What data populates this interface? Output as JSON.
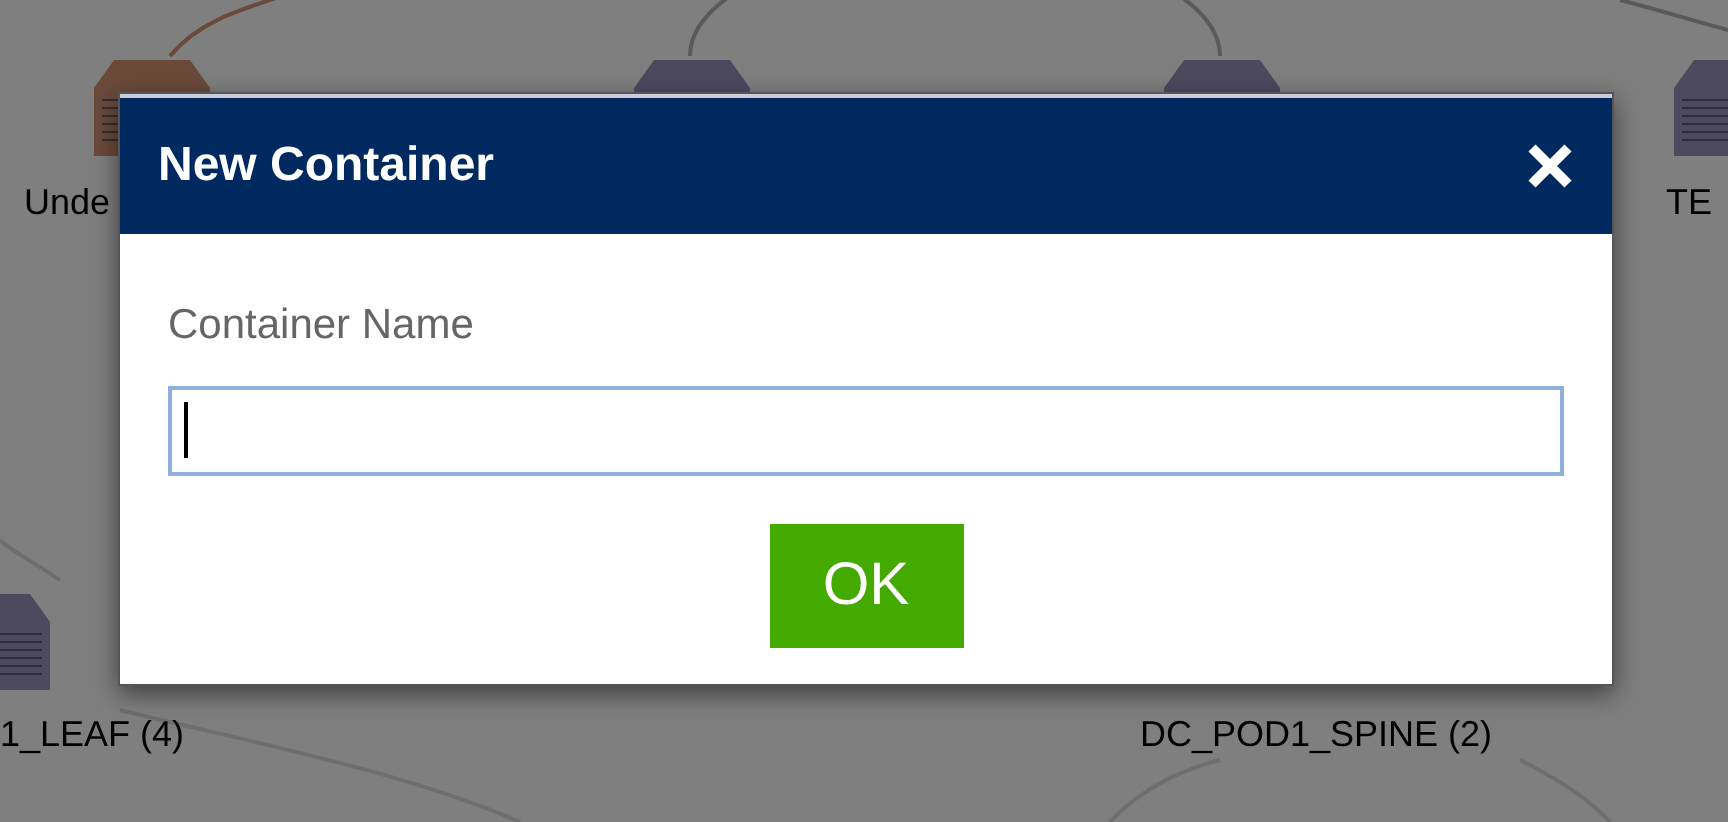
{
  "canvas": {
    "nodes": [
      {
        "label": "Unde",
        "color": "#6b4a3a"
      },
      {
        "color": "#4d4a60"
      },
      {
        "color": "#4d4a60"
      },
      {
        "label": "TE",
        "color": "#4d4a60"
      },
      {
        "label": "1_LEAF (4)",
        "color": "#4d4a60"
      },
      {
        "label": "DC_POD1_SPINE (2)"
      }
    ]
  },
  "dialog": {
    "title": "New Container",
    "field_label": "Container Name",
    "ok_button": "OK"
  }
}
